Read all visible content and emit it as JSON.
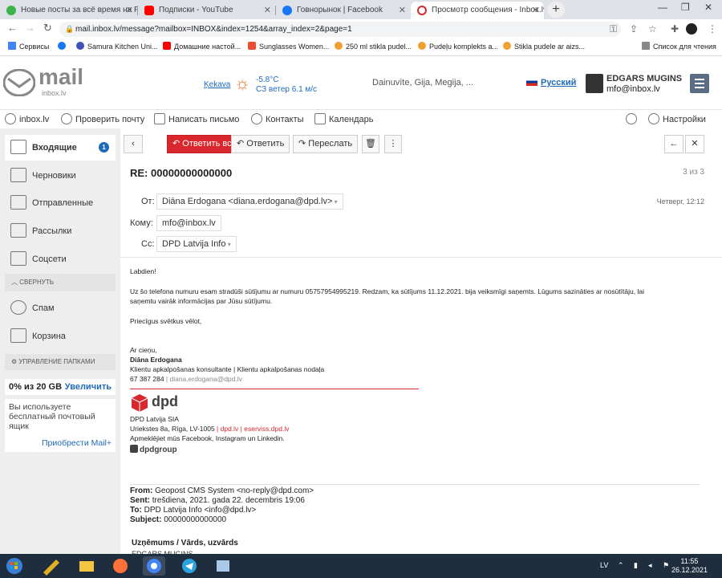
{
  "browser": {
    "tabs": [
      {
        "title": "Новые посты за всё время на F",
        "color": "#3cb44b"
      },
      {
        "title": "Подписки - YouTube",
        "color": "#ff0000"
      },
      {
        "title": "Говнорынок | Facebook",
        "color": "#1877f2"
      },
      {
        "title": "Просмотр сообщения - Inbox.lv",
        "color": "#d8282e"
      }
    ],
    "url": "mail.inbox.lv/message?mailbox=INBOX&index=1254&array_index=2&page=1",
    "bookmarks": [
      "Сервисы",
      "Samura Kitchen Uni...",
      "Домашние настой...",
      "Sunglasses Women...",
      "250 ml stikla pudel...",
      "Pudeļu komplekts a...",
      "Stikla pudele ar aizs..."
    ],
    "reading_list": "Список для чтения"
  },
  "header": {
    "logo_text": "mail",
    "logo_sub": "inbox.lv",
    "city": "Ķekava",
    "temp": "-5.8°C",
    "wind": "СЗ ветер 6.1 м/с",
    "namedays": "Dainuvīte, Gija, Megija, ...",
    "language": "Русский",
    "user_name": "EDGARS MUGINS",
    "user_email": "mfo@inbox.lv"
  },
  "toolbar": {
    "inbox": "inbox.lv",
    "check": "Проверить почту",
    "write": "Написать письмо",
    "contacts": "Контакты",
    "calendar": "Календарь",
    "settings": "Настройки"
  },
  "sidebar": {
    "folders": [
      {
        "label": "Входящие",
        "badge": "1"
      },
      {
        "label": "Черновики"
      },
      {
        "label": "Отправленные"
      },
      {
        "label": "Рассылки"
      },
      {
        "label": "Соцсети"
      }
    ],
    "collapse": "СВЕРНУТЬ",
    "folders2": [
      {
        "label": "Спам"
      },
      {
        "label": "Корзина"
      }
    ],
    "manage": "УПРАВЛЕНИЕ ПАПКАМИ",
    "quota": "0% из 20 GB",
    "upgrade": "Увеличить",
    "promo_text": "Вы используете бесплатный почтовый ящик",
    "promo_link": "Приобрести Mail+"
  },
  "message": {
    "actions": {
      "reply_all": "Ответить всем",
      "reply": "Ответить",
      "forward": "Переслать"
    },
    "subject": "RE: 00000000000000",
    "counter": "3 из 3",
    "from_label": "От:",
    "from": "Diāna Erdogana  <diana.erdogana@dpd.lv>",
    "date": "Четверг, 12:12",
    "to_label": "Кому:",
    "to": "mfo@inbox.lv",
    "cc_label": "Cc:",
    "cc": "DPD Latvija Info",
    "greeting": "Labdien!",
    "para1": "Uz šo telefona numuru esam stradūši sūtījumu ar numuru 05757954995219. Redzam, ka sūtījums 11.12.2021. bija veiksmīgi saņemts. Lūgums sazināties ar nosūtītāju, lai",
    "para1b": "saņemtu vairāk informācijas par Jūsu sūtījumu.",
    "wishes": "Priecīgus svētkus vēlot,",
    "regards": "Ar cieņu,",
    "sig_name": "Diāna Erdogana",
    "sig_title": "Klientu apkalpošanas konsultante | Klientu apkalpošanas nodaļa",
    "sig_phone": "67 387 284",
    "sig_email": "diana.erdogana@dpd.lv",
    "dpd_logo": "dpd",
    "company": "DPD Latvija SIA",
    "address": "Uriekstes 8a, Rīga, LV-1005",
    "site1": "dpd.lv",
    "site2": "eserviss.dpd.lv",
    "social": "Apmeklējiet mūs Facebook, Instagram un Linkedin.",
    "group_logo": "dpdgroup",
    "fwd_from_l": "From:",
    "fwd_from": "Geopost CMS System <no-reply@dpd.com>",
    "fwd_sent_l": "Sent:",
    "fwd_sent": "trešdiena, 2021. gada 22. decembris 19:06",
    "fwd_to_l": "To:",
    "fwd_to": "DPD Latvija Info <info@dpd.lv>",
    "fwd_subj_l": "Subject:",
    "fwd_subj": "00000000000000",
    "company_field": "Uzņēmums / Vārds, uzvārds",
    "company_value": "EDGARS MUGINS"
  },
  "taskbar": {
    "lang": "LV",
    "time": "11:55",
    "date": "26.12.2021"
  }
}
